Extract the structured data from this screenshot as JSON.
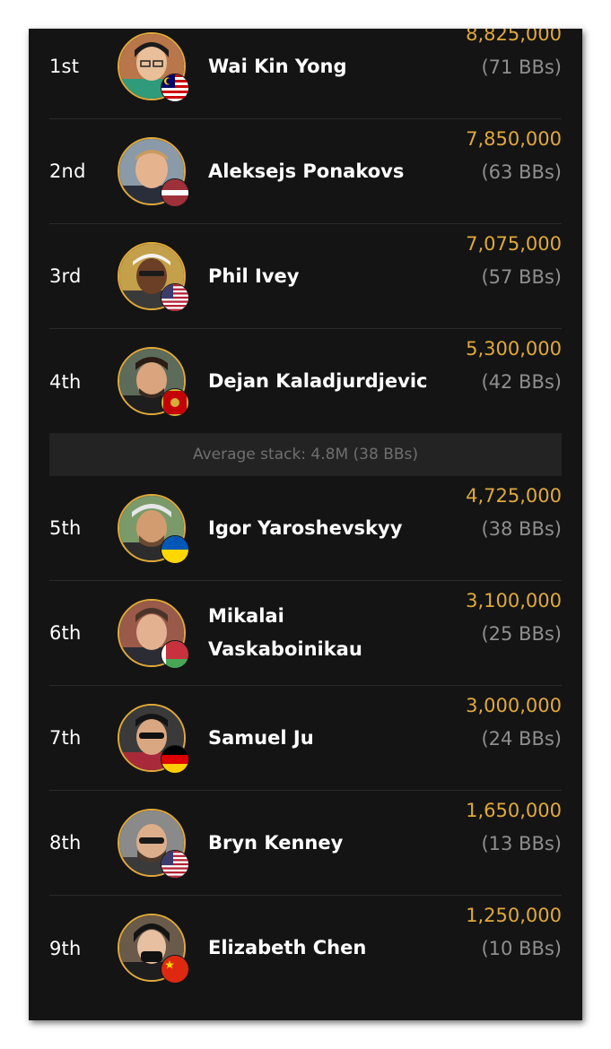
{
  "players": [
    {
      "rank": "1st",
      "name": "Wai Kin Yong",
      "chips": "8,825,000",
      "bbs": "(71 BBs)",
      "flag": "malaysia-flag-icon"
    },
    {
      "rank": "2nd",
      "name": "Aleksejs Ponakovs",
      "chips": "7,850,000",
      "bbs": "(63 BBs)",
      "flag": "latvia-flag-icon"
    },
    {
      "rank": "3rd",
      "name": "Phil Ivey",
      "chips": "7,075,000",
      "bbs": "(57 BBs)",
      "flag": "usa-flag-icon"
    },
    {
      "rank": "4th",
      "name": "Dejan Kaladjurdjevic",
      "chips": "5,300,000",
      "bbs": "(42 BBs)",
      "flag": "montenegro-flag-icon"
    },
    {
      "rank": "5th",
      "name": "Igor Yaroshevskyy",
      "chips": "4,725,000",
      "bbs": "(38 BBs)",
      "flag": "ukraine-flag-icon"
    },
    {
      "rank": "6th",
      "name": "Mikalai Vaskaboinikau",
      "chips": "3,100,000",
      "bbs": "(25 BBs)",
      "flag": "belarus-flag-icon"
    },
    {
      "rank": "7th",
      "name": "Samuel Ju",
      "chips": "3,000,000",
      "bbs": "(24 BBs)",
      "flag": "germany-flag-icon"
    },
    {
      "rank": "8th",
      "name": "Bryn Kenney",
      "chips": "1,650,000",
      "bbs": "(13 BBs)",
      "flag": "usa-flag-icon"
    },
    {
      "rank": "9th",
      "name": "Elizabeth Chen",
      "chips": "1,250,000",
      "bbs": "(10 BBs)",
      "flag": "china-flag-icon"
    }
  ],
  "average_stack": "Average stack: 4.8M (38 BBs)",
  "colors": {
    "background": "#141414",
    "accent_gold": "#e0a93a",
    "muted_text": "#8e8e8e",
    "avg_bar": "#232323"
  }
}
